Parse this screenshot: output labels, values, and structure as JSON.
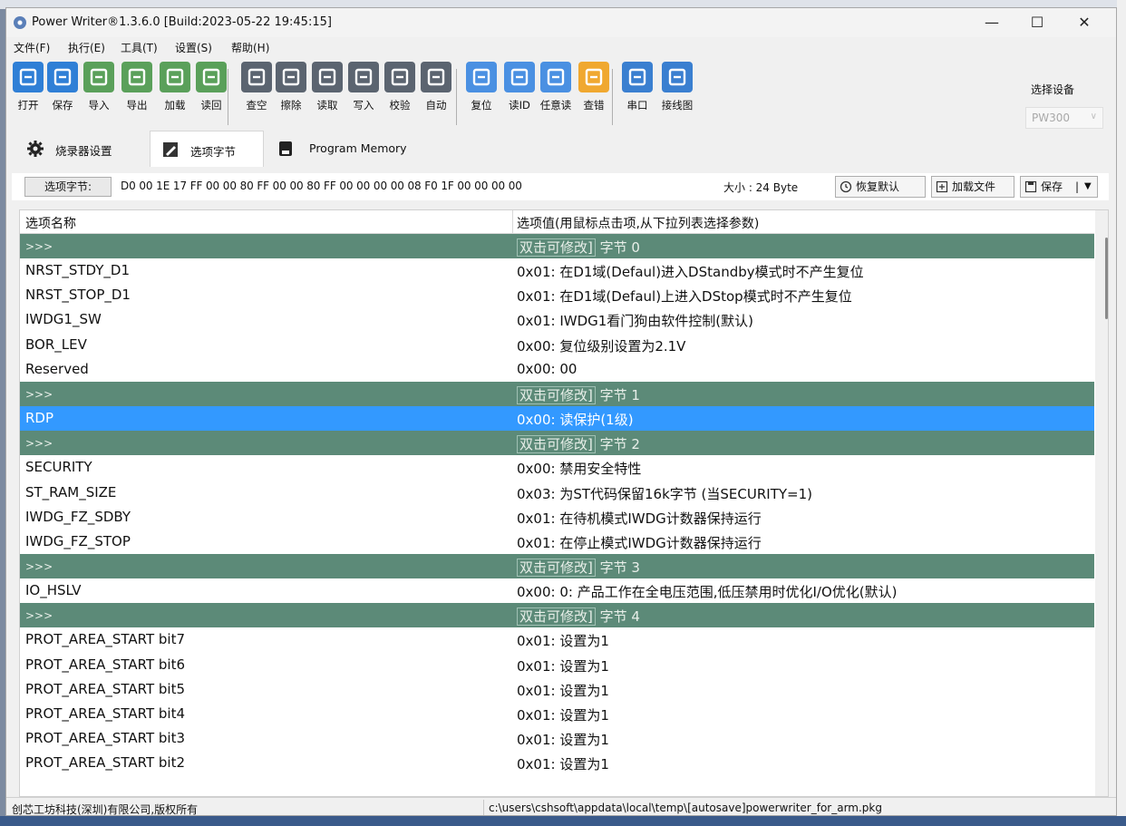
{
  "window": {
    "title": "Power Writer®1.3.6.0 [Build:2023-05-22 19:45:15]",
    "minimize_glyph": "—",
    "maximize_glyph": "☐",
    "close_glyph": "✕"
  },
  "menu": [
    "文件(F)",
    "执行(E)",
    "工具(T)",
    "设置(S)",
    "帮助(H)"
  ],
  "toolbar": {
    "buttons": [
      {
        "label": "打开",
        "icon": "folder-open-icon",
        "color": "#2f7fd6"
      },
      {
        "label": "保存",
        "icon": "save-icon",
        "color": "#2f7fd6"
      },
      {
        "label": "导入",
        "icon": "import-icon",
        "color": "#5aa05a"
      },
      {
        "label": "导出",
        "icon": "export-icon",
        "color": "#5aa05a"
      },
      {
        "label": "加载",
        "icon": "load-icon",
        "color": "#5aa05a"
      },
      {
        "label": "读回",
        "icon": "readback-icon",
        "color": "#5aa05a"
      },
      {
        "label": "查空",
        "icon": "search-icon",
        "color": "#5b6470"
      },
      {
        "label": "擦除",
        "icon": "erase-icon",
        "color": "#5b6470"
      },
      {
        "label": "读取",
        "icon": "read-icon",
        "color": "#5b6470"
      },
      {
        "label": "写入",
        "icon": "write-icon",
        "color": "#5b6470"
      },
      {
        "label": "校验",
        "icon": "verify-icon",
        "color": "#5b6470"
      },
      {
        "label": "自动",
        "icon": "robot-icon",
        "color": "#5b6470"
      },
      {
        "label": "复位",
        "icon": "reset-icon",
        "color": "#4a90e2"
      },
      {
        "label": "读ID",
        "icon": "id-icon",
        "color": "#4a90e2"
      },
      {
        "label": "任意读",
        "icon": "any-read-icon",
        "color": "#4a90e2"
      },
      {
        "label": "查错",
        "icon": "error-check-icon",
        "color": "#f0a830"
      },
      {
        "label": "串口",
        "icon": "serial-port-icon",
        "color": "#3a7fd0"
      },
      {
        "label": "接线图",
        "icon": "wiring-diagram-icon",
        "color": "#3a7fd0"
      }
    ],
    "device_label": "选择设备",
    "device_value": "PW300"
  },
  "tabs": [
    {
      "label": "烧录器设置",
      "icon": "gear-icon"
    },
    {
      "label": "选项字节",
      "icon": "edit-icon"
    },
    {
      "label": "Program Memory",
      "icon": "memory-icon"
    }
  ],
  "option_bar": {
    "label": "选项字节:",
    "bytes": "D0 00 1E 17 FF 00 00 80 FF 00 00 80 FF 00 00 00 00 08 F0 1F 00 00 00 00",
    "size": "大小 : 24 Byte",
    "restore": "恢复默认",
    "load_file": "加载文件",
    "save": "保存"
  },
  "grid": {
    "headers": [
      "选项名称",
      "选项值(用鼠标点击项,从下拉列表选择参数)"
    ],
    "rows": [
      {
        "type": "section",
        "name": ">>>",
        "value_box": "双击可修改]",
        "value_rest": " 字节 0"
      },
      {
        "type": "item",
        "name": "NRST_STDY_D1",
        "value": "0x01: 在D1域(Defaul)进入DStandby模式时不产生复位"
      },
      {
        "type": "item",
        "name": "NRST_STOP_D1",
        "value": "0x01: 在D1域(Defaul)上进入DStop模式时不产生复位"
      },
      {
        "type": "item",
        "name": "IWDG1_SW",
        "value": "0x01: IWDG1看门狗由软件控制(默认)"
      },
      {
        "type": "item",
        "name": "BOR_LEV",
        "value": "0x00: 复位级别设置为2.1V"
      },
      {
        "type": "item",
        "name": "Reserved",
        "value": "0x00: 00"
      },
      {
        "type": "section",
        "name": ">>>",
        "value_box": "双击可修改]",
        "value_rest": " 字节 1"
      },
      {
        "type": "selected",
        "name": "RDP",
        "value": "0x00: 读保护(1级)"
      },
      {
        "type": "section",
        "name": ">>>",
        "value_box": "双击可修改]",
        "value_rest": " 字节 2"
      },
      {
        "type": "item",
        "name": "SECURITY",
        "value": "0x00: 禁用安全特性"
      },
      {
        "type": "item",
        "name": "ST_RAM_SIZE",
        "value": "0x03: 为ST代码保留16k字节 (当SECURITY=1)"
      },
      {
        "type": "item",
        "name": "IWDG_FZ_SDBY",
        "value": "0x01: 在待机模式IWDG计数器保持运行"
      },
      {
        "type": "item",
        "name": "IWDG_FZ_STOP",
        "value": "0x01: 在停止模式IWDG计数器保持运行"
      },
      {
        "type": "section",
        "name": ">>>",
        "value_box": "双击可修改]",
        "value_rest": " 字节 3"
      },
      {
        "type": "item",
        "name": "IO_HSLV",
        "value": "0x00: 0: 产品工作在全电压范围,低压禁用时优化I/O优化(默认)"
      },
      {
        "type": "section",
        "name": ">>>",
        "value_box": "双击可修改]",
        "value_rest": " 字节 4"
      },
      {
        "type": "item",
        "name": "PROT_AREA_START bit7",
        "value": "0x01: 设置为1"
      },
      {
        "type": "item",
        "name": "PROT_AREA_START bit6",
        "value": "0x01: 设置为1"
      },
      {
        "type": "item",
        "name": "PROT_AREA_START bit5",
        "value": "0x01: 设置为1"
      },
      {
        "type": "item",
        "name": "PROT_AREA_START bit4",
        "value": "0x01: 设置为1"
      },
      {
        "type": "item",
        "name": "PROT_AREA_START bit3",
        "value": "0x01: 设置为1"
      },
      {
        "type": "item",
        "name": "PROT_AREA_START bit2",
        "value": "0x01: 设置为1"
      }
    ]
  },
  "status": {
    "company": "创芯工坊科技(深圳)有限公司,版权所有",
    "path": "c:\\users\\cshsoft\\appdata\\local\\temp\\[autosave]powerwriter_for_arm.pkg"
  },
  "colors": {
    "section_row": "#5c8a78",
    "selected_row": "#3399ff"
  }
}
